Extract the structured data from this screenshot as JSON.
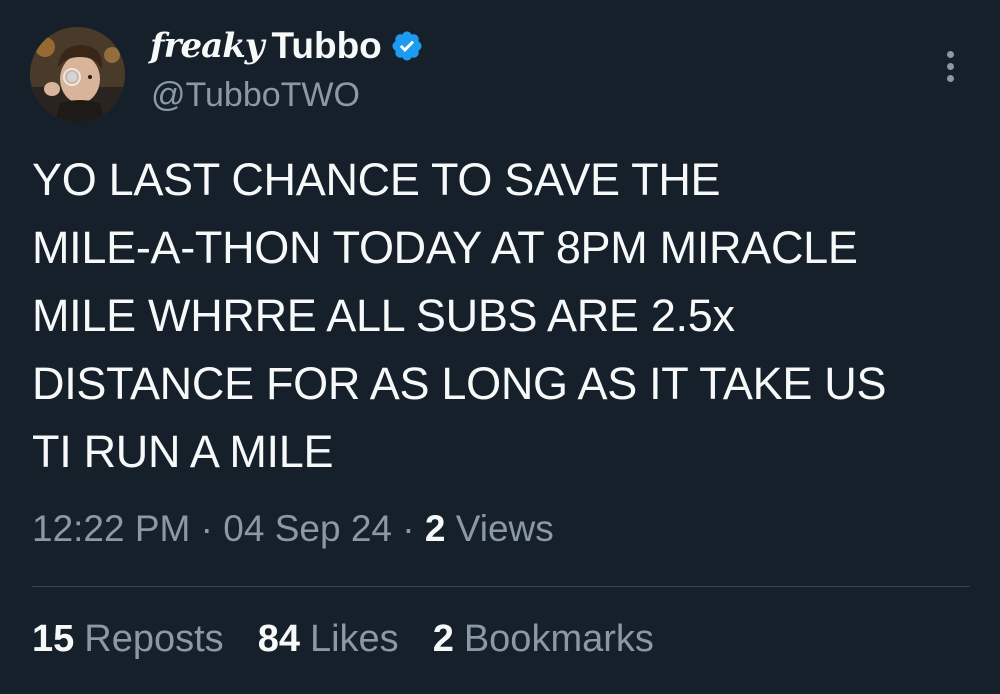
{
  "author": {
    "name_prefix": "freaky",
    "name": "Tubbo",
    "handle": "@TubboTWO",
    "verified": true
  },
  "tweet": {
    "lines": [
      "YO LAST CHANCE TO SAVE THE",
      "MILE-A-THON TODAY AT 8PM MIRACLE",
      "MILE WHRRE ALL SUBS ARE 2.5x",
      "DISTANCE FOR AS LONG AS IT TAKE US",
      "TI RUN A MILE"
    ]
  },
  "meta": {
    "time": "12:22 PM",
    "sep1": "·",
    "date": "04 Sep 24",
    "sep2": "·",
    "views_count": "2",
    "views_label": "Views"
  },
  "stats": {
    "reposts_count": "15",
    "reposts_label": "Reposts",
    "likes_count": "84",
    "likes_label": "Likes",
    "bookmarks_count": "2",
    "bookmarks_label": "Bookmarks"
  },
  "icons": {
    "verified": "verified-badge-icon",
    "more": "more-options-icon"
  },
  "colors": {
    "background": "#15202b",
    "text": "#f7f9f9",
    "secondary_text": "#8b98a5",
    "verified_blue": "#1d9bf0",
    "divider": "#38444d"
  }
}
